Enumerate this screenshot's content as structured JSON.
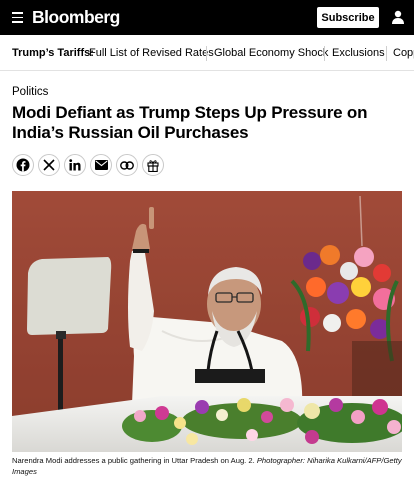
{
  "header": {
    "logo_text": "Bloomberg",
    "subscribe_label": "Subscribe",
    "menu_icon": "hamburger-menu-icon",
    "account_icon": "user-account-icon",
    "background_color": "#000000"
  },
  "nav": {
    "items": [
      {
        "label": "Trump’s Tariffs:",
        "emphasis": true
      },
      {
        "label": "Full List of Revised Rates",
        "emphasis": false
      },
      {
        "label": "Global Economy Shock",
        "emphasis": false
      },
      {
        "label": "Exclusions",
        "emphasis": false
      },
      {
        "label": "Copp",
        "emphasis": false
      }
    ]
  },
  "article": {
    "section": "Politics",
    "headline": "Modi Defiant as Trump Steps Up Pressure on India’s Russian Oil Purchases",
    "share_icons": [
      "facebook-icon",
      "x-icon",
      "linkedin-icon",
      "email-icon",
      "link-icon",
      "gift-icon"
    ],
    "image_alt": "Narendra Modi addresses a public gathering in Uttar Pradesh on Aug. 2.",
    "caption_text": "Narendra Modi addresses a public gathering in Uttar Pradesh on Aug. 2. ",
    "caption_credit": "Photographer: Niharika Kulkarni/AFP/Getty Images"
  }
}
